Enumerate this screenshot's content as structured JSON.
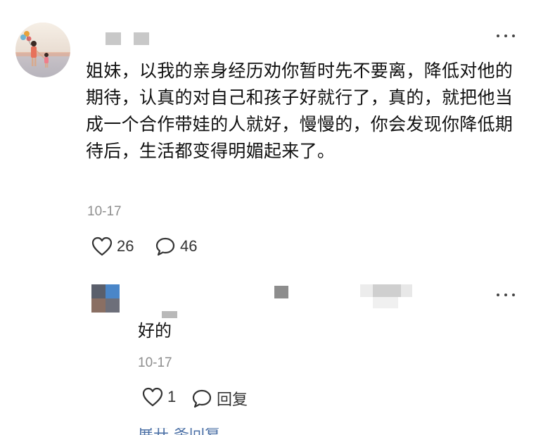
{
  "comment": {
    "author_name": "",
    "text": "姐妹，以我的亲身经历劝你暂时先不要离，降低对他的期待，认真的对自己和孩子好就行了，真的，就把他当成一个合作带娃的人就好，慢慢的，你会发现你降低期待后，生活都变得明媚起来了。",
    "date": "10-17",
    "like_count": "26",
    "reply_count": "46"
  },
  "reply": {
    "author_name": "",
    "text": "好的",
    "date": "10-17",
    "like_count": "1",
    "reply_label": "回复"
  },
  "footer_partial_text": "展开 条回复",
  "colors": {
    "date_gray": "#8e8e8e",
    "icon_dark": "#333333",
    "link_blue": "#4a6fa5"
  }
}
